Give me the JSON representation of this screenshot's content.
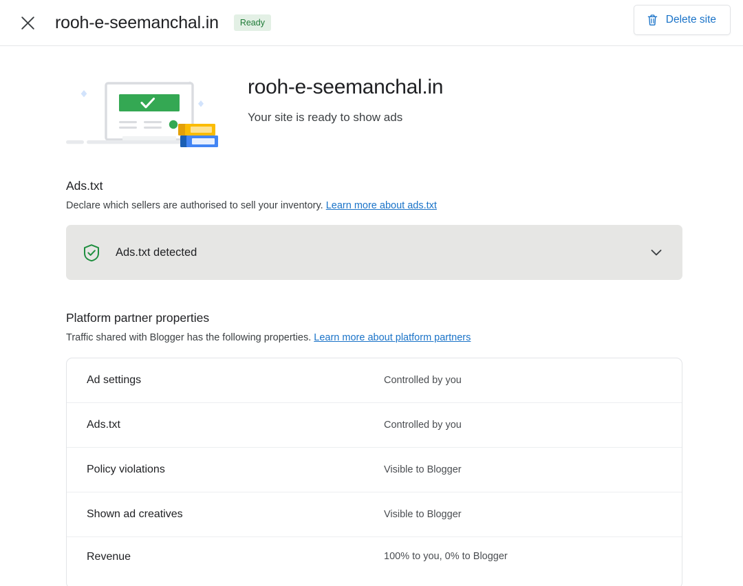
{
  "appbar": {
    "close_icon": "close-icon",
    "title": "rooh-e-seemanchal.in",
    "status_badge": "Ready",
    "delete_button": "Delete site",
    "delete_icon": "trash-icon",
    "accent_blue": "#1a73c8",
    "badge_bg": "#e3f0e5",
    "badge_fg": "#1e7a36"
  },
  "hero": {
    "illustration": "laptop-success-illustration",
    "title": "rooh-e-seemanchal.in",
    "subtitle": "Your site is ready to show ads"
  },
  "ads_txt": {
    "heading": "Ads.txt",
    "description": "Declare which sellers are authorised to sell your inventory.",
    "link": "Learn more about ads.txt",
    "panel": {
      "icon": "shield-check-icon",
      "icon_color": "#1e8e3e",
      "label": "Ads.txt detected",
      "expand_icon": "chevron-down-icon",
      "background": "#e6e6e4"
    }
  },
  "platform_partners": {
    "heading": "Platform partner properties",
    "description": "Traffic shared with Blogger has the following properties.",
    "link": "Learn more about platform partners",
    "rows": [
      {
        "label": "Ad settings",
        "value": "Controlled by you"
      },
      {
        "label": "Ads.txt",
        "value": "Controlled by you"
      },
      {
        "label": "Policy violations",
        "value": "Visible to Blogger"
      },
      {
        "label": "Shown ad creatives",
        "value": "Visible to Blogger"
      },
      {
        "label": "Revenue",
        "value": "100% to you, 0% to Blogger"
      }
    ]
  }
}
